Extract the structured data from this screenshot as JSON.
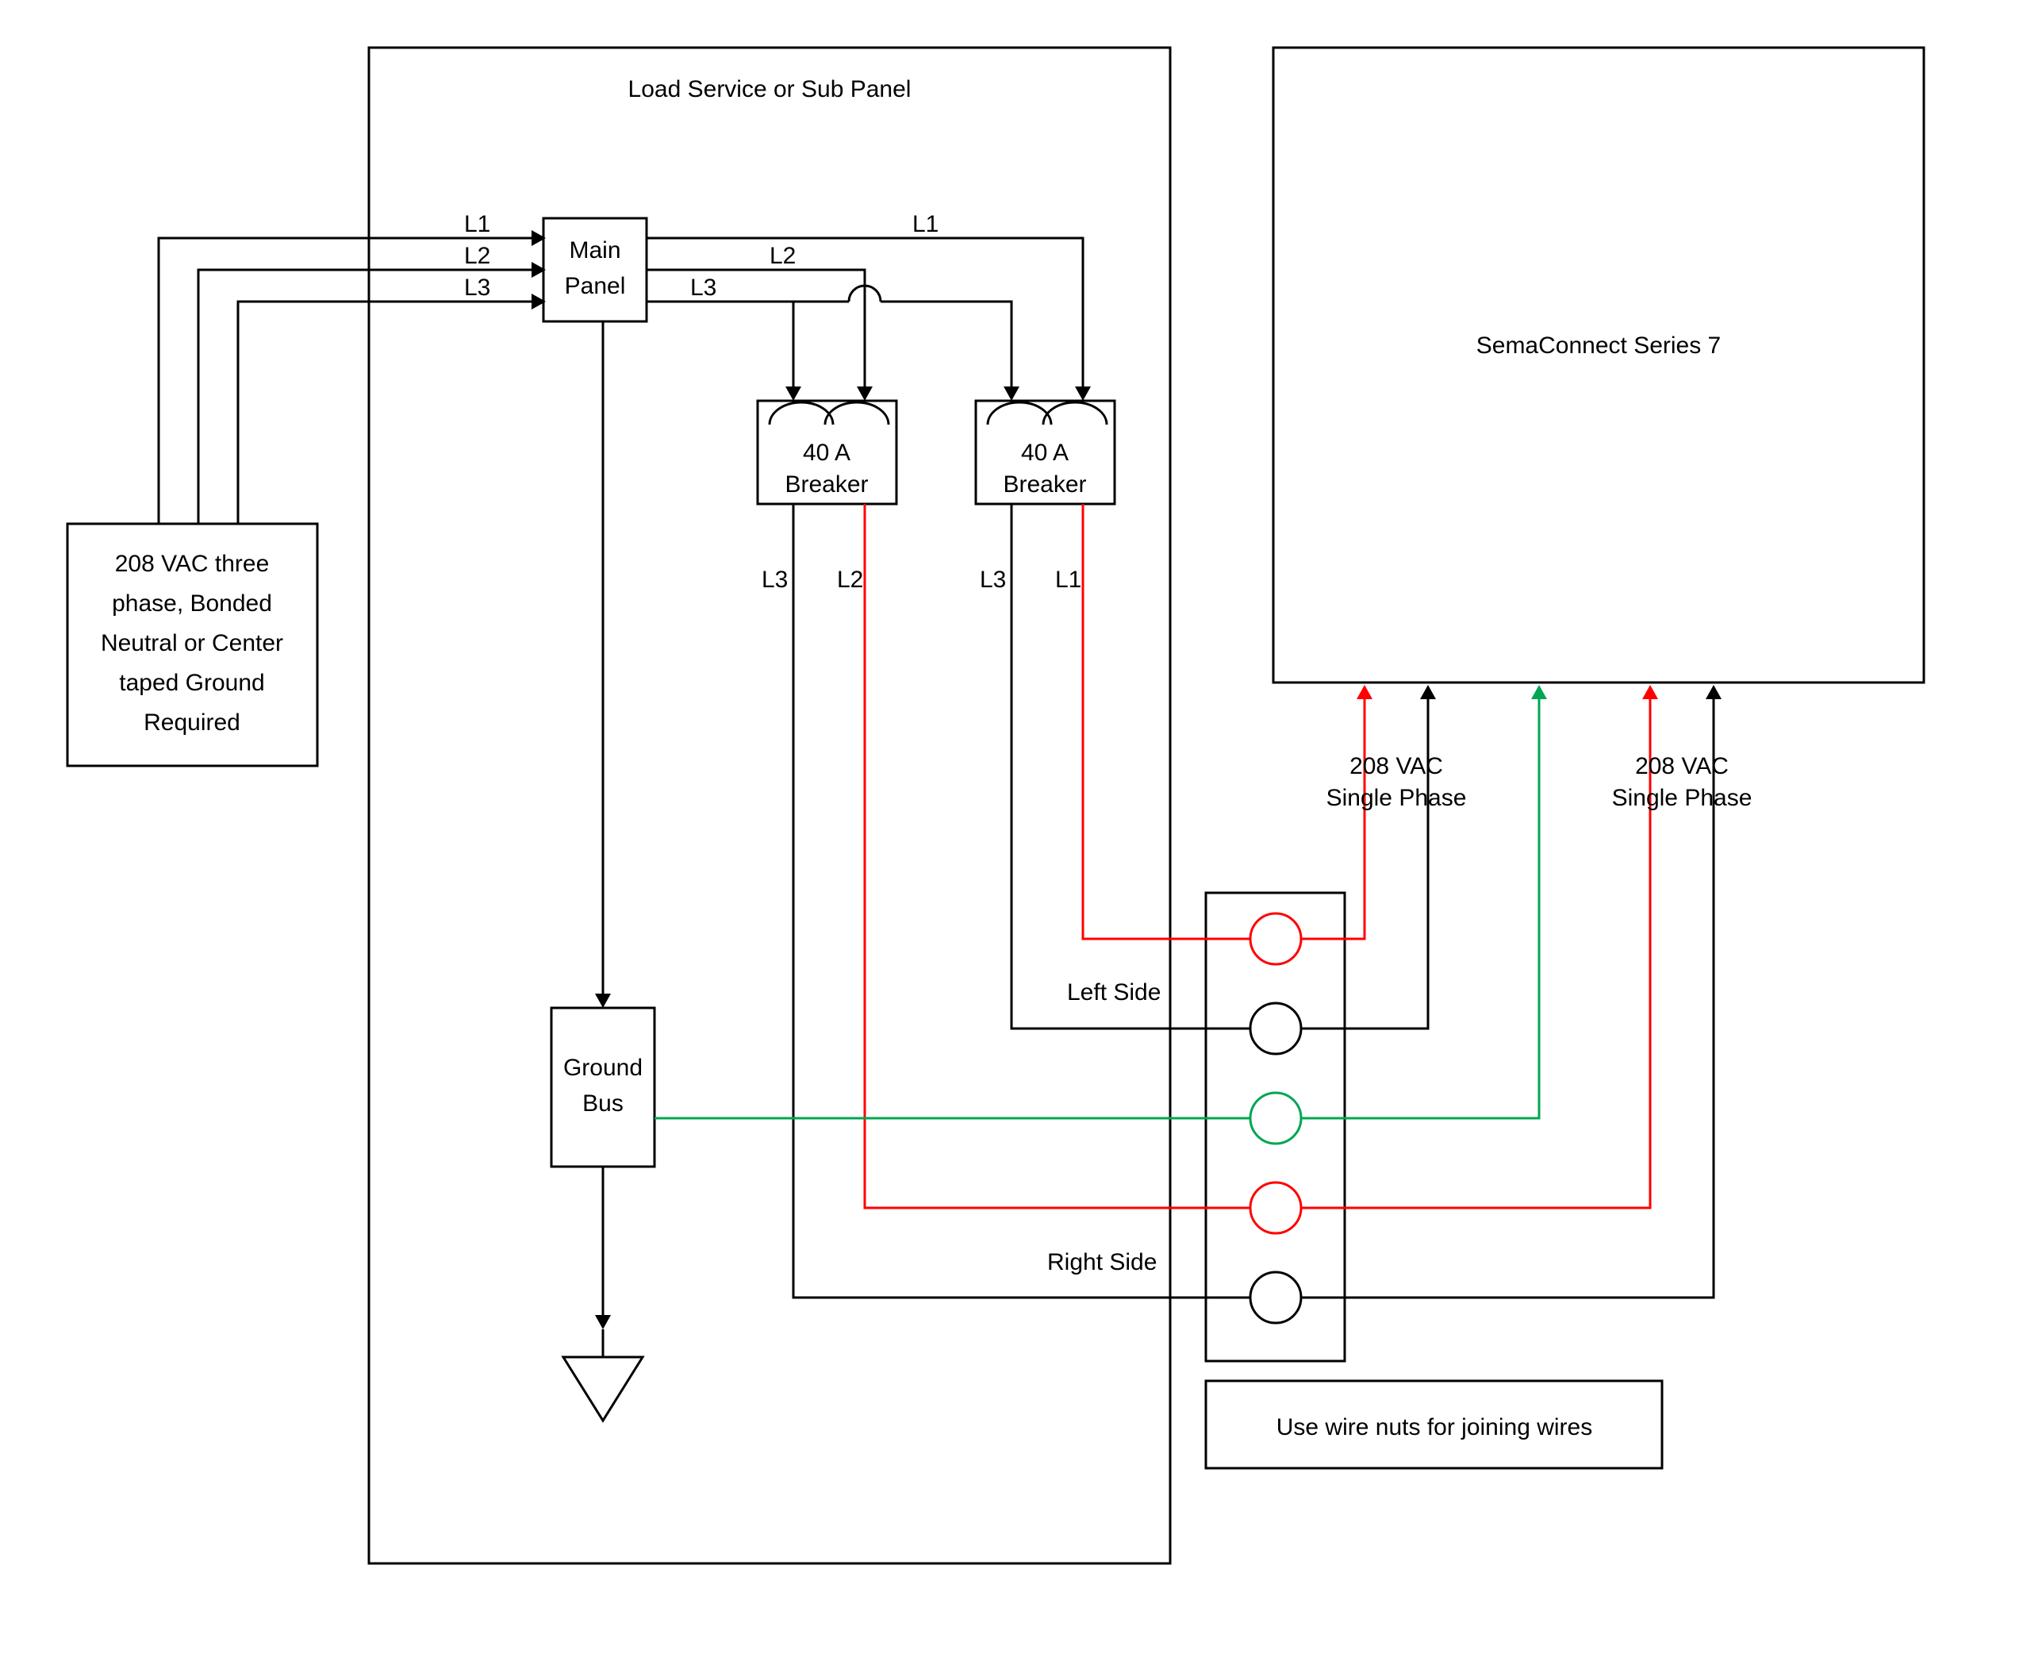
{
  "panel": {
    "title": "Load Service or Sub Panel"
  },
  "source": {
    "line1": "208 VAC three",
    "line2": "phase, Bonded",
    "line3": "Neutral or Center",
    "line4": "taped Ground",
    "line5": "Required"
  },
  "main_panel": {
    "line1": "Main",
    "line2": "Panel"
  },
  "breaker1": {
    "rating": "40 A",
    "label": "Breaker"
  },
  "breaker2": {
    "rating": "40 A",
    "label": "Breaker"
  },
  "ground_bus": {
    "line1": "Ground",
    "line2": "Bus"
  },
  "lines": {
    "L1": "L1",
    "L2": "L2",
    "L3": "L3"
  },
  "sides": {
    "left": "Left Side",
    "right": "Right Side"
  },
  "device": {
    "title": "SemaConnect Series 7"
  },
  "power_left": {
    "line1": "208 VAC",
    "line2": "Single Phase"
  },
  "power_right": {
    "line1": "208 VAC",
    "line2": "Single Phase"
  },
  "wire_nuts_note": "Use wire nuts for joining wires"
}
